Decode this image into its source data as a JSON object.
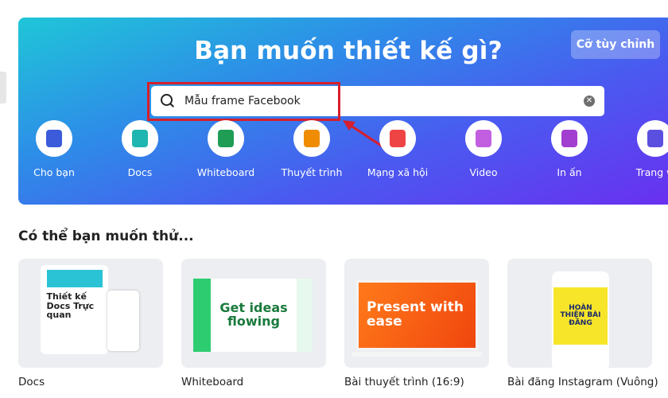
{
  "banner": {
    "title": "Bạn muốn thiết kế gì?",
    "custom_size_label": "Cỡ tùy chỉnh"
  },
  "search": {
    "value": "Mẫu frame Facebook",
    "icon": "search-icon",
    "clear_icon": "clear-icon"
  },
  "categories": [
    {
      "label": "Cho bạn",
      "icon": "sparkle-icon",
      "color": "#3b5bdb"
    },
    {
      "label": "Docs",
      "icon": "docs-icon",
      "color": "#1fb5b0"
    },
    {
      "label": "Whiteboard",
      "icon": "whiteboard-icon",
      "color": "#1f9d55"
    },
    {
      "label": "Thuyết trình",
      "icon": "presentation-icon",
      "color": "#f08c00"
    },
    {
      "label": "Mạng xã hội",
      "icon": "social-heart-icon",
      "color": "#ef4444"
    },
    {
      "label": "Video",
      "icon": "video-icon",
      "color": "#c25fe0"
    },
    {
      "label": "In ấn",
      "icon": "print-icon",
      "color": "#a23fd0"
    },
    {
      "label": "Trang w",
      "icon": "website-icon",
      "color": "#5b4fe0"
    }
  ],
  "section_title": "Có thể bạn muốn thử...",
  "cards": [
    {
      "label": "Docs",
      "thumb_text": "Thiết kế Docs Trực quan"
    },
    {
      "label": "Whiteboard",
      "thumb_text": "Get ideas flowing"
    },
    {
      "label": "Bài thuyết trình (16:9)",
      "thumb_text": "Present with ease"
    },
    {
      "label": "Bài đăng Instagram (Vuông)",
      "thumb_text": "HOÀN THIỆN BÀI ĐĂNG"
    }
  ],
  "colors": {
    "highlight": "#d61f2c"
  }
}
